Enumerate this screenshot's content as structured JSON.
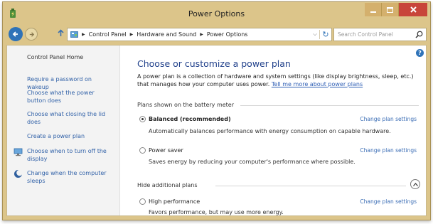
{
  "window": {
    "title": "Power Options"
  },
  "nav": {
    "breadcrumbs": [
      "Control Panel",
      "Hardware and Sound",
      "Power Options"
    ],
    "search_placeholder": "Search Control Panel"
  },
  "sidebar": {
    "home": "Control Panel Home",
    "links": [
      {
        "label": "Require a password on wakeup"
      },
      {
        "label": "Choose what the power button does"
      },
      {
        "label": "Choose what closing the lid does"
      },
      {
        "label": "Create a power plan"
      },
      {
        "label": "Choose when to turn off the display",
        "icon": "display-icon"
      },
      {
        "label": "Change when the computer sleeps",
        "icon": "moon-icon"
      }
    ]
  },
  "main": {
    "title": "Choose or customize a power plan",
    "description": "A power plan is a collection of hardware and system settings (like display brightness, sleep, etc.) that manages how your computer uses power.",
    "learn_more": "Tell me more about power plans",
    "section_battery": "Plans shown on the battery meter",
    "section_hidden": "Hide additional plans",
    "plans": [
      {
        "name": "Balanced (recommended)",
        "description": "Automatically balances performance with energy consumption on capable hardware.",
        "change": "Change plan settings",
        "selected": true
      },
      {
        "name": "Power saver",
        "description": "Saves energy by reducing your computer's performance where possible.",
        "change": "Change plan settings",
        "selected": false
      },
      {
        "name": "High performance",
        "description": "Favors performance, but may use more energy.",
        "change": "Change plan settings",
        "selected": false
      }
    ]
  },
  "colors": {
    "titlebar": "#dcc58a",
    "close_button": "#c8453a",
    "link": "#3262a8",
    "heading": "#1f3f8a"
  }
}
